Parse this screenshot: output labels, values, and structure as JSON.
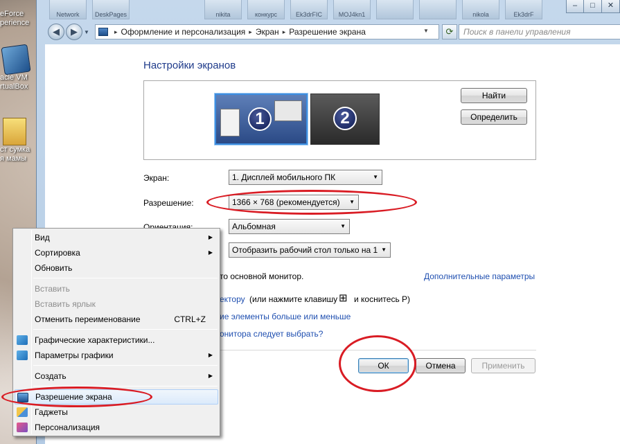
{
  "desktop": {
    "icons": [
      {
        "line1": "eForce",
        "line2": "perience"
      },
      {
        "line1": "acle VM",
        "line2": "rtualBox"
      },
      {
        "line1": "ст сумка",
        "line2": "я мамы"
      }
    ]
  },
  "window": {
    "taskbar_thumbs": [
      "Network",
      "DeskPages",
      "nikita",
      "конкурс",
      "Ek3drFIC",
      "MOJ4kn1",
      "",
      "",
      "nikola",
      "Ek3drF"
    ],
    "buttons": {
      "minimize": "–",
      "maximize": "□",
      "close": "✕"
    },
    "address": {
      "segments": [
        "Оформление и персонализация",
        "Экран",
        "Разрешение экрана"
      ],
      "separator": "▸"
    },
    "search_placeholder": "Поиск в панели управления"
  },
  "page": {
    "heading": "Настройки экранов",
    "monitors": [
      "1",
      "2"
    ],
    "find_button": "Найти",
    "identify_button": "Определить",
    "screen_label": "Экран:",
    "screen_value": "1. Дисплей мобильного ПК",
    "resolution_label": "Разрешение:",
    "resolution_value": "1366 × 768 (рекомендуется)",
    "orientation_label": "Ориентация:",
    "orientation_value": "Альбомная",
    "multi_display_value": "Отобразить рабочий стол только на 1",
    "main_monitor_text": "то основной монитор.",
    "advanced_link": "Дополнительные параметры",
    "projector_link": "ектору",
    "projector_text": "(или нажмите клавишу",
    "projector_text2": "и коснитесь P)",
    "text_size_link": "ие элементы больше или меньше",
    "which_monitor_link": "онитора следует выбрать?",
    "ok_button": "ОК",
    "cancel_button": "Отмена",
    "apply_button": "Применить"
  },
  "context_menu": {
    "items": [
      {
        "label": "Вид",
        "submenu": true
      },
      {
        "label": "Сортировка",
        "submenu": true
      },
      {
        "label": "Обновить"
      },
      {
        "label": "Вставить",
        "disabled": true
      },
      {
        "label": "Вставить ярлык",
        "disabled": true
      },
      {
        "label": "Отменить переименование",
        "shortcut": "CTRL+Z"
      },
      {
        "label": "Графические характеристики..."
      },
      {
        "label": "Параметры графики",
        "submenu": true
      },
      {
        "label": "Создать",
        "submenu": true
      },
      {
        "label": "Разрешение экрана",
        "highlighted": true
      },
      {
        "label": "Гаджеты"
      },
      {
        "label": "Персонализация"
      }
    ],
    "submenu_arrow": "▶"
  },
  "colors": {
    "annotation": "#d91c24",
    "link": "#1f4fb0",
    "heading": "#1e3a8a"
  }
}
